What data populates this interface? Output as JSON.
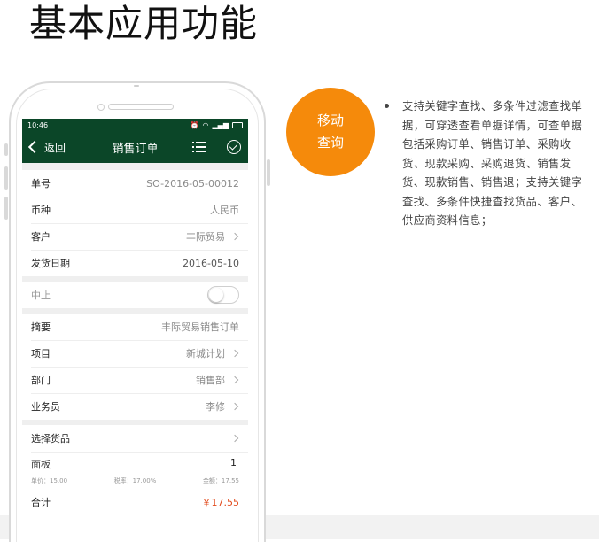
{
  "page": {
    "title": "基本应用功能"
  },
  "phone": {
    "status_bar": {
      "time": "10:46"
    },
    "nav": {
      "back_label": "返回",
      "title": "销售订单"
    },
    "fields": {
      "order_no_label": "单号",
      "order_no_value": "SO-2016-05-00012",
      "currency_label": "币种",
      "currency_value": "人民币",
      "customer_label": "客户",
      "customer_value": "丰际贸易",
      "ship_date_label": "发货日期",
      "ship_date_value": "2016-05-10",
      "suspend_label": "中止",
      "summary_label": "摘要",
      "summary_value": "丰际贸易销售订单",
      "project_label": "项目",
      "project_value": "新城计划",
      "dept_label": "部门",
      "dept_value": "销售部",
      "salesman_label": "业务员",
      "salesman_value": "李修",
      "choose_goods_label": "选择货品"
    },
    "product": {
      "name": "面板",
      "qty": "1",
      "unit_price": "单价：15.00",
      "tax_rate": "税率：17.00%",
      "amount": "金额：17.55"
    },
    "total": {
      "label": "合计",
      "value": "￥17.55"
    }
  },
  "badge": {
    "line1": "移动",
    "line2": "查询"
  },
  "feature": {
    "text": "支持关键字查找、多条件过滤查找单据，可穿透查看单据详情，可查单据包括采购订单、销售订单、采购收货、现款采购、采购退货、销售发货、现款销售、销售退；支持关键字查找、多条件快捷查找货品、客户、供应商资料信息；"
  },
  "colors": {
    "header_green": "#0b4628",
    "badge_orange": "#f58a0b",
    "total_red": "#e24b1d"
  }
}
